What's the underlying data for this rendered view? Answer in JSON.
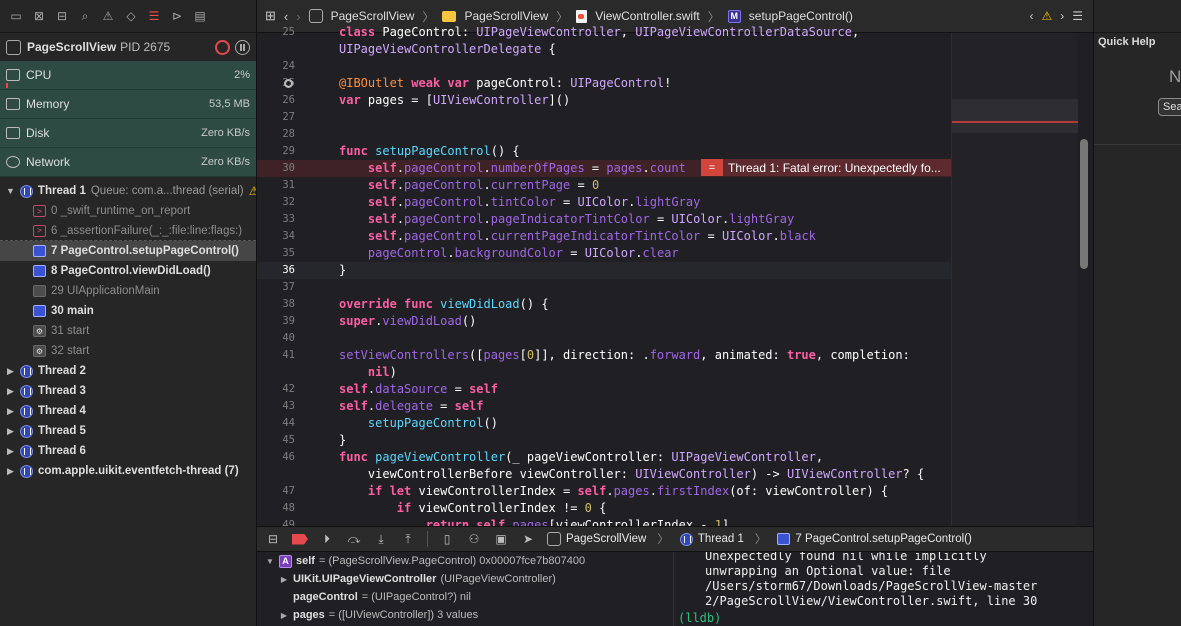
{
  "process": {
    "name": "PageScrollView",
    "pid": "PID 2675"
  },
  "gauges": [
    {
      "label": "CPU",
      "value": "2%"
    },
    {
      "label": "Memory",
      "value": "53,5 MB"
    },
    {
      "label": "Disk",
      "value": "Zero KB/s"
    },
    {
      "label": "Network",
      "value": "Zero KB/s"
    }
  ],
  "thread1": {
    "label": "Thread 1",
    "queue": "Queue: com.a...thread (serial)"
  },
  "frames": [
    {
      "label": "0 _swift_runtime_on_report"
    },
    {
      "label": "6 _assertionFailure(_:_:file:line:flags:)"
    },
    {
      "label": "7 PageControl.setupPageControl()"
    },
    {
      "label": "8 PageControl.viewDidLoad()"
    },
    {
      "label": "29 UIApplicationMain"
    },
    {
      "label": "30 main"
    },
    {
      "label": "31 start"
    },
    {
      "label": "32 start"
    }
  ],
  "threads": [
    "Thread 2",
    "Thread 3",
    "Thread 4",
    "Thread 5",
    "Thread 6",
    "com.apple.uikit.eventfetch-thread (7)"
  ],
  "jump_bar": {
    "project": "PageScrollView",
    "folder": "PageScrollView",
    "file": "ViewController.swift",
    "method_badge": "M",
    "method": "setupPageControl()"
  },
  "line_numbers": [
    "25",
    "",
    "24",
    "25",
    "26",
    "27",
    "28",
    "29",
    "30",
    "31",
    "32",
    "33",
    "34",
    "35",
    "36",
    "37",
    "38",
    "39",
    "40",
    "41",
    "",
    "42",
    "43",
    "44",
    "45",
    "46",
    "",
    "47",
    "48",
    "49"
  ],
  "error": {
    "message": "Thread 1: Fatal error: Unexpectedly fo...",
    "x": "="
  },
  "debug_bar": {
    "scheme": "PageScrollView",
    "thread": "Thread 1",
    "frame": "7 PageControl.setupPageControl()"
  },
  "variables": [
    {
      "badge": "A",
      "name": "self",
      "value": "= (PageScrollView.PageControl) 0x00007fce7b807400"
    },
    {
      "name": "UIKit.UIPageViewController",
      "value": "(UIPageViewController)"
    },
    {
      "name": "pageControl",
      "value": "= (UIPageControl?) nil"
    },
    {
      "name": "pages",
      "value": "= ([UIViewController]) 3 values"
    }
  ],
  "console": {
    "lines": [
      "Unexpectedly found nil while implicitly",
      "unwrapping an Optional value: file",
      "/Users/storm67/Downloads/PageScrollView-master",
      "2/PageScrollView/ViewController.swift, line 30"
    ],
    "prompt": "(lldb)"
  },
  "inspector": {
    "title": "Quick Help",
    "big_text": "N",
    "search": "Sea"
  },
  "colors": {
    "error": "#d1453b",
    "keyword": "#fc5fa3",
    "type": "#d0a8ff",
    "property": "#a167e6",
    "thread_icon": "#2f47b8"
  }
}
